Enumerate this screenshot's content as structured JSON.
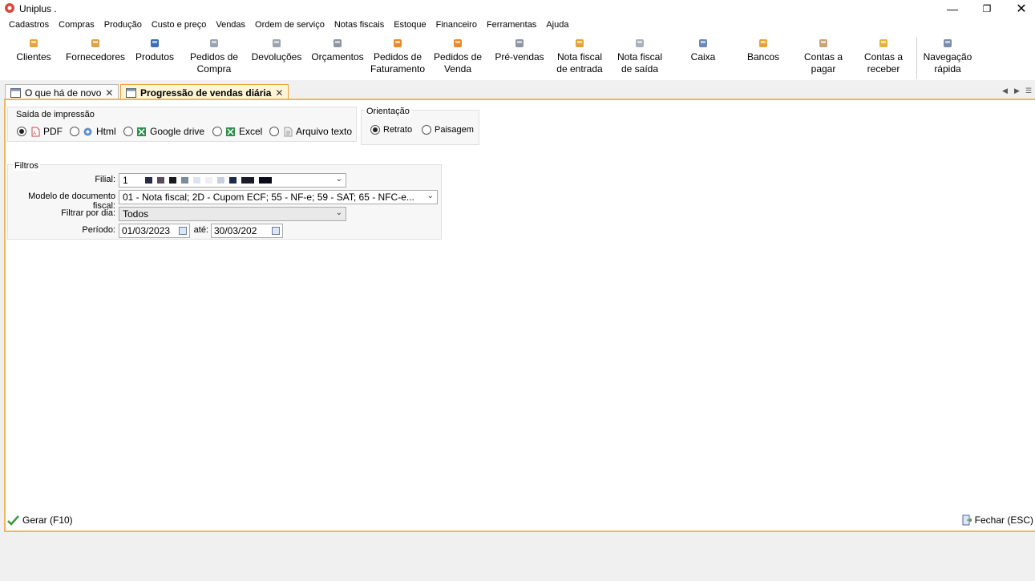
{
  "window": {
    "title": "Uniplus .",
    "min_icon": "minimize-icon",
    "max_icon": "restore-icon",
    "close_icon": "close-icon"
  },
  "menu": [
    "Cadastros",
    "Compras",
    "Produção",
    "Custo e preço",
    "Vendas",
    "Ordem de serviço",
    "Notas fiscais",
    "Estoque",
    "Financeiro",
    "Ferramentas",
    "Ajuda"
  ],
  "toolbar": [
    {
      "label": "Clientes",
      "icon": "person-icon",
      "color": "#e3a33a"
    },
    {
      "label": "Fornecedores",
      "icon": "supplier-icon",
      "color": "#d9a24b"
    },
    {
      "label": "Produtos",
      "icon": "product-icon",
      "color": "#3d6fb8"
    },
    {
      "label": "Pedidos de\nCompra",
      "icon": "purchase-order-icon",
      "color": "#9aa3b0"
    },
    {
      "label": "Devoluções",
      "icon": "return-icon",
      "color": "#9aa3b0"
    },
    {
      "label": "Orçamentos",
      "icon": "quote-icon",
      "color": "#8d95a3"
    },
    {
      "label": "Pedidos de\nFaturamento",
      "icon": "billing-order-icon",
      "color": "#e8892e"
    },
    {
      "label": "Pedidos de\nVenda",
      "icon": "sales-order-icon",
      "color": "#e8892e"
    },
    {
      "label": "Pré-vendas",
      "icon": "presale-icon",
      "color": "#8d95a3"
    },
    {
      "label": "Nota fiscal\nde entrada",
      "icon": "invoice-in-icon",
      "color": "#e3a33a"
    },
    {
      "label": "Nota fiscal\nde saída",
      "icon": "invoice-out-icon",
      "color": "#a9b0bb"
    },
    {
      "label": "Caixa",
      "icon": "cash-icon",
      "color": "#6a88b8"
    },
    {
      "label": "Bancos",
      "icon": "bank-icon",
      "color": "#e3a33a"
    },
    {
      "label": "Contas a\npagar",
      "icon": "payable-icon",
      "color": "#c9a27a"
    },
    {
      "label": "Contas a\nreceber",
      "icon": "receivable-icon",
      "color": "#e3b23a"
    },
    {
      "label": "Navegação\nrápida",
      "icon": "quick-nav-icon",
      "color": "#7a8ea8"
    }
  ],
  "tabs": [
    {
      "label": "O que há de novo",
      "icon": "window-icon"
    },
    {
      "label": "Progressão de vendas diária",
      "icon": "window-icon"
    }
  ],
  "print_output": {
    "legend": "Saída de impressão",
    "options": [
      {
        "label": "PDF",
        "selected": true,
        "icon": "pdf-icon"
      },
      {
        "label": "Html",
        "selected": false,
        "icon": "html-icon"
      },
      {
        "label": "Google drive",
        "selected": false,
        "icon": "google-drive-icon"
      },
      {
        "label": "Excel",
        "selected": false,
        "icon": "excel-icon"
      },
      {
        "label": "Arquivo texto",
        "selected": false,
        "icon": "text-file-icon"
      }
    ]
  },
  "orientation": {
    "legend": "Orientação",
    "options": [
      {
        "label": "Retrato",
        "selected": true
      },
      {
        "label": "Paisagem",
        "selected": false
      }
    ]
  },
  "filters": {
    "legend": "Filtros",
    "filial_label": "Filial:",
    "filial_value": "1",
    "modelo_label": "Modelo de documento fiscal:",
    "modelo_value": "01 - Nota fiscal; 2D - Cupom ECF; 55 - NF-e; 59 - SAT; 65 - NFC-e...",
    "dia_label": "Filtrar por dia:",
    "dia_value": "Todos",
    "periodo_label": "Período:",
    "periodo_start": "01/03/2023",
    "ate_label": "até:",
    "periodo_end": "30/03/202"
  },
  "actions": {
    "gerar": "Gerar (F10)",
    "fechar": "Fechar (ESC)"
  }
}
